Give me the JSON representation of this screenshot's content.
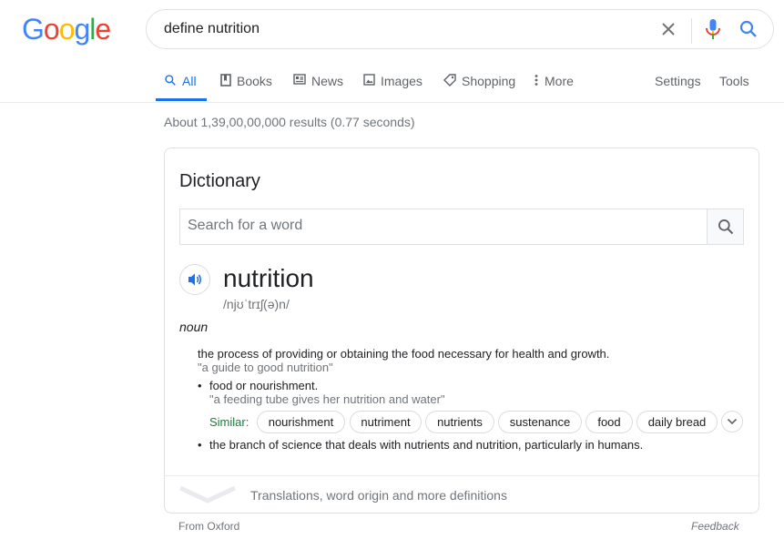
{
  "logo": {
    "letters": [
      "G",
      "o",
      "o",
      "g",
      "l",
      "e"
    ],
    "colors": [
      "#4285f4",
      "#ea4335",
      "#fbbc05",
      "#4285f4",
      "#34a853",
      "#ea4335"
    ]
  },
  "search": {
    "query": "define nutrition"
  },
  "tabs": [
    {
      "label": "All",
      "icon": "search-icon"
    },
    {
      "label": "Books",
      "icon": "book-icon"
    },
    {
      "label": "News",
      "icon": "news-icon"
    },
    {
      "label": "Images",
      "icon": "image-icon"
    },
    {
      "label": "Shopping",
      "icon": "tag-icon"
    },
    {
      "label": "More",
      "icon": "more-vert-icon"
    }
  ],
  "tools": {
    "settings": "Settings",
    "tools": "Tools"
  },
  "stats": "About 1,39,00,00,000 results (0.77 seconds)",
  "dictionary": {
    "title": "Dictionary",
    "search_placeholder": "Search for a word",
    "word": "nutrition",
    "phonetic": "/njʊˈtrɪʃ(ə)n/",
    "part_of_speech": "noun",
    "definitions": [
      {
        "text": "the process of providing or obtaining the food necessary for health and growth.",
        "example": "\"a guide to good nutrition\""
      },
      {
        "text": "food or nourishment.",
        "example": "\"a feeding tube gives her nutrition and water\""
      },
      {
        "text": "the branch of science that deals with nutrients and nutrition, particularly in humans.",
        "example": ""
      }
    ],
    "similar_label": "Similar:",
    "similar": [
      "nourishment",
      "nutriment",
      "nutrients",
      "sustenance",
      "food",
      "daily bread"
    ],
    "more_label": "Translations, word origin and more definitions",
    "source": "From Oxford",
    "feedback": "Feedback"
  },
  "accent": "#1a73e8"
}
